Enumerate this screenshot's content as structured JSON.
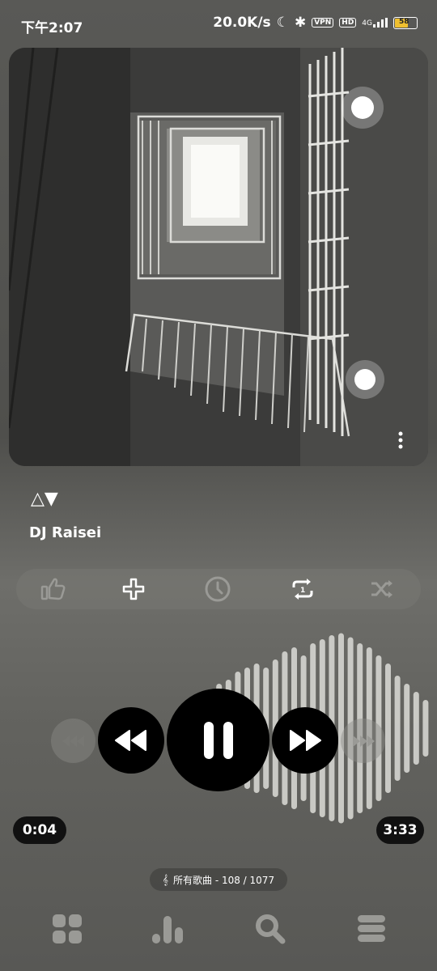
{
  "status": {
    "time": "下午2:07",
    "speed": "20.0K/s",
    "vpn": "VPN",
    "hd": "HD",
    "network": "4G",
    "battery": "58"
  },
  "track": {
    "title": "△▼",
    "artist": "DJ Raisei"
  },
  "progress": {
    "elapsed": "0:04",
    "total": "3:33",
    "fraction": 0.019
  },
  "playlist": {
    "label": "所有歌曲 - 108 / 1077"
  },
  "icons": {
    "actions": [
      "thumbs-up-icon",
      "plus-icon",
      "clock-icon",
      "repeat-one-icon",
      "shuffle-icon"
    ],
    "controls": [
      "skip-back-icon",
      "rewind-icon",
      "pause-icon",
      "fast-forward-icon",
      "skip-forward-icon"
    ],
    "nav": [
      "grid-icon",
      "bar-chart-icon",
      "search-icon",
      "menu-icon"
    ]
  },
  "colors": {
    "accent": "#000000",
    "battery": "#f0c030"
  }
}
